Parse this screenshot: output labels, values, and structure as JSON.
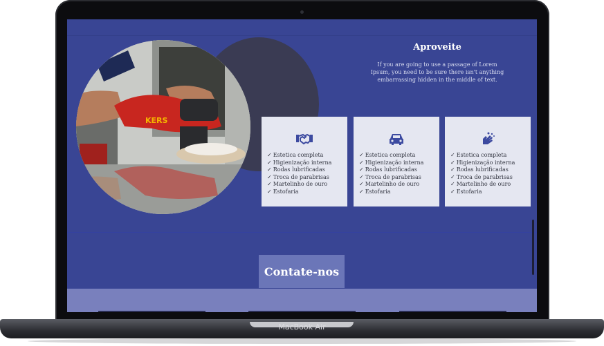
{
  "device": {
    "label": "MacBook Air"
  },
  "section": {
    "title": "Aproveite",
    "text": "If you are going to use a passage of Lorem Ipsum, you need to be sure there isn't anything embarrassing hidden in the middle of text."
  },
  "photo": {
    "subject": "car polishing machine",
    "brand_text": "KERS"
  },
  "cards": [
    {
      "icon": "handshake-icon",
      "items": [
        "Estetica completa",
        "Higienização interna",
        "Rodas lubrificadas",
        "Troca de parabrisas",
        "Martelinho de ouro",
        "Estofaria"
      ]
    },
    {
      "icon": "car-icon",
      "items": [
        "Estetica completa",
        "Higienização interna",
        "Rodas lubrificadas",
        "Troca de parabrisas",
        "Martelinho de ouro",
        "Estofaria"
      ]
    },
    {
      "icon": "hand-washing-icon",
      "items": [
        "Estetica completa",
        "Higienização interna",
        "Rodas lubrificadas",
        "Troca de parabrisas",
        "Martelinho de ouro",
        "Estofaria"
      ]
    }
  ],
  "contact": {
    "label": "Contate-nos"
  },
  "colors": {
    "page_bg": "#394594",
    "card_bg": "#e5e7f1",
    "icon": "#3c4aa0",
    "contact_bg": "#6b76b8",
    "footer_band": "#7980bd"
  }
}
